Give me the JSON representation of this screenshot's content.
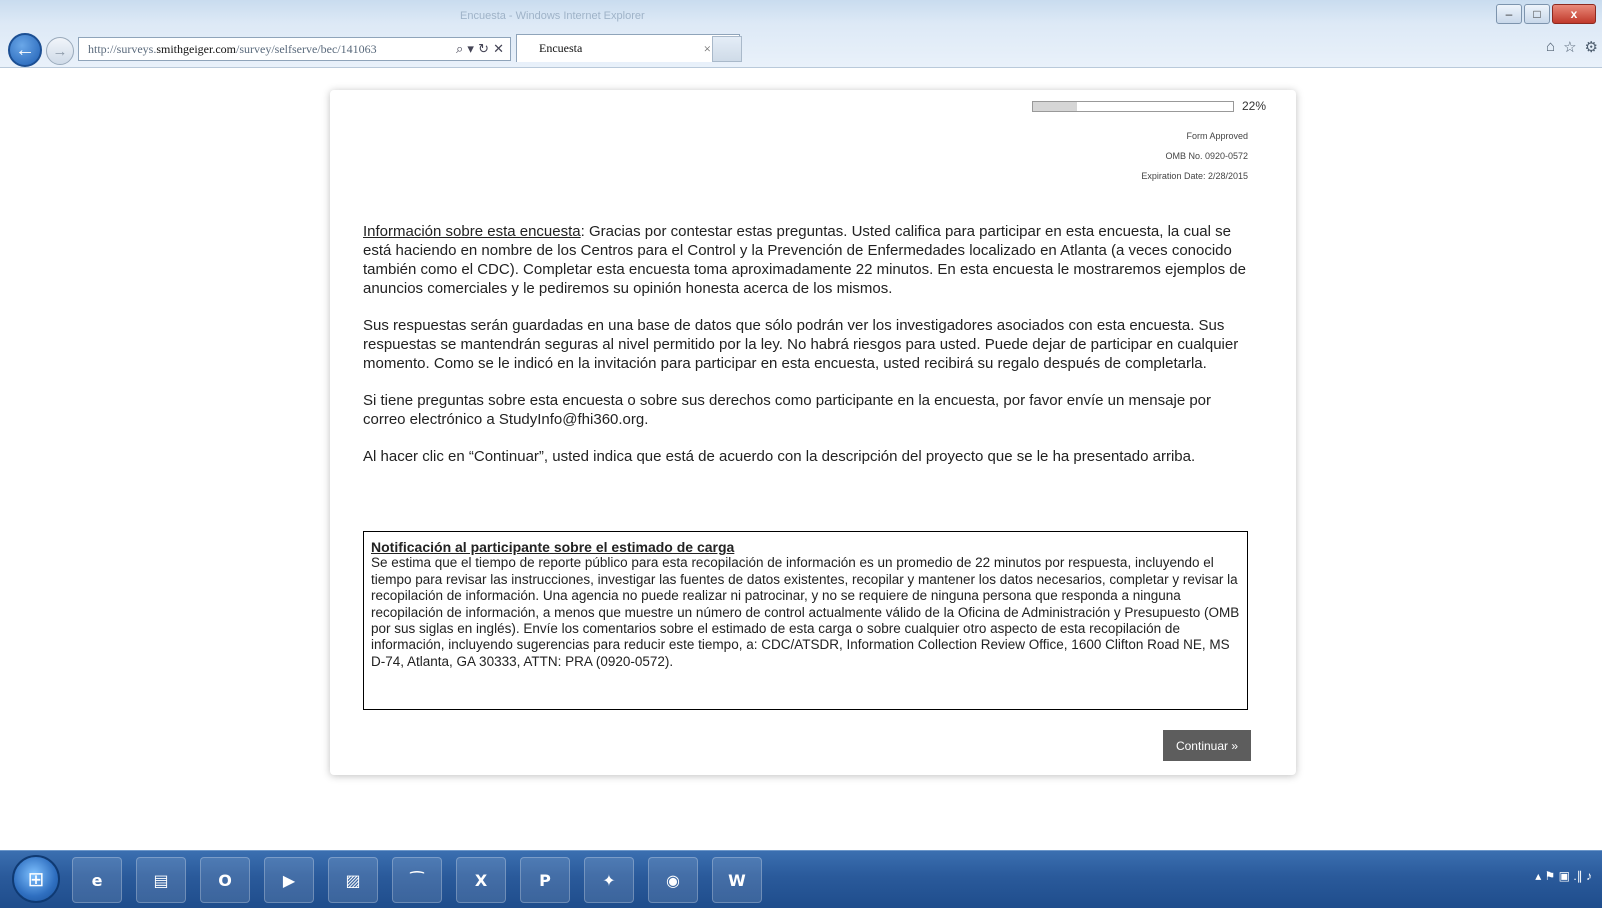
{
  "browser": {
    "title_text": "Encuesta - Windows Internet Explorer",
    "url_prefix": "http://surveys.",
    "url_domain": "smithgeiger.com",
    "url_path": "/survey/selfserve/bec/141063",
    "addr_tools": "⌕ ▾ ↻ ✕",
    "tab_label": "Encuesta",
    "tab_close": "×",
    "minimize": "–",
    "maximize": "□",
    "close": "x",
    "back": "←",
    "forward": "→",
    "home": "⌂",
    "favorites": "☆",
    "settings": "⚙"
  },
  "survey": {
    "progress_percent": 22,
    "progress_label": "22%",
    "form_approved": "Form Approved",
    "omb_number": "OMB No. 0920-0572",
    "expiration": "Expiration Date: 2/28/2015",
    "intro_heading": "Información sobre esta encuesta",
    "intro_text": ": Gracias por contestar estas preguntas. Usted califica para participar en esta encuesta, la cual se está haciendo en nombre de los Centros para el Control y la Prevención de Enfermedades localizado en Atlanta (a veces conocido también como el CDC). Completar esta encuesta toma aproximadamente 22 minutos. En esta encuesta le mostraremos ejemplos de anuncios comerciales y le pediremos su opinión honesta acerca de los mismos.",
    "paragraph2": "Sus respuestas serán guardadas en una base de datos que sólo podrán ver los investigadores asociados con esta encuesta. Sus respuestas se mantendrán seguras al nivel permitido por la ley. No habrá riesgos para usted. Puede dejar de participar en cualquier momento. Como se le indicó en la invitación para participar en esta encuesta, usted recibirá su regalo después de completarla.",
    "paragraph3": "Si tiene preguntas sobre esta encuesta o sobre sus derechos como participante en la encuesta, por favor envíe un mensaje por correo electrónico a StudyInfo@fhi360.org.",
    "paragraph4": "Al hacer clic en “Continuar”, usted indica que está de acuerdo con la descripción del proyecto que se le ha presentado arriba.",
    "notice_title": "Notificación al participante sobre el estimado de carga",
    "notice_text": "Se estima que el tiempo de reporte público para esta recopilación de información es un promedio de 22 minutos por respuesta, incluyendo el tiempo para revisar las instrucciones, investigar las fuentes de datos existentes, recopilar y mantener los datos necesarios, completar y revisar la recopilación de información. Una agencia no puede realizar ni patrocinar, y no se requiere de ninguna persona que responda a ninguna recopilación de información, a menos que muestre un número de control actualmente válido de la Oficina de Administración y Presupuesto (OMB por sus siglas en inglés). Envíe los comentarios sobre el estimado de esta carga o sobre cualquier otro aspecto de esta recopilación de información, incluyendo sugerencias para reducir este tiempo, a: CDC/ATSDR, Information Collection Review Office, 1600 Clifton Road NE, MS D-74, Atlanta, GA 30333, ATTN: PRA (0920-0572).",
    "continue_label": "Continuar »"
  },
  "taskbar": {
    "start_glyph": "⊞",
    "apps": [
      {
        "name": "internet-explorer",
        "glyph": "e"
      },
      {
        "name": "file-explorer",
        "glyph": "▤"
      },
      {
        "name": "outlook",
        "glyph": "O"
      },
      {
        "name": "media-player",
        "glyph": "▶"
      },
      {
        "name": "folder",
        "glyph": "▨"
      },
      {
        "name": "acrobat",
        "glyph": "⁀"
      },
      {
        "name": "excel",
        "glyph": "X"
      },
      {
        "name": "powerpoint",
        "glyph": "P"
      },
      {
        "name": "app-icon",
        "glyph": "✦"
      },
      {
        "name": "chrome",
        "glyph": "◉"
      },
      {
        "name": "word",
        "glyph": "W"
      }
    ],
    "tray_icons": "▴  ⚑  ▣  .∥  ♪"
  }
}
